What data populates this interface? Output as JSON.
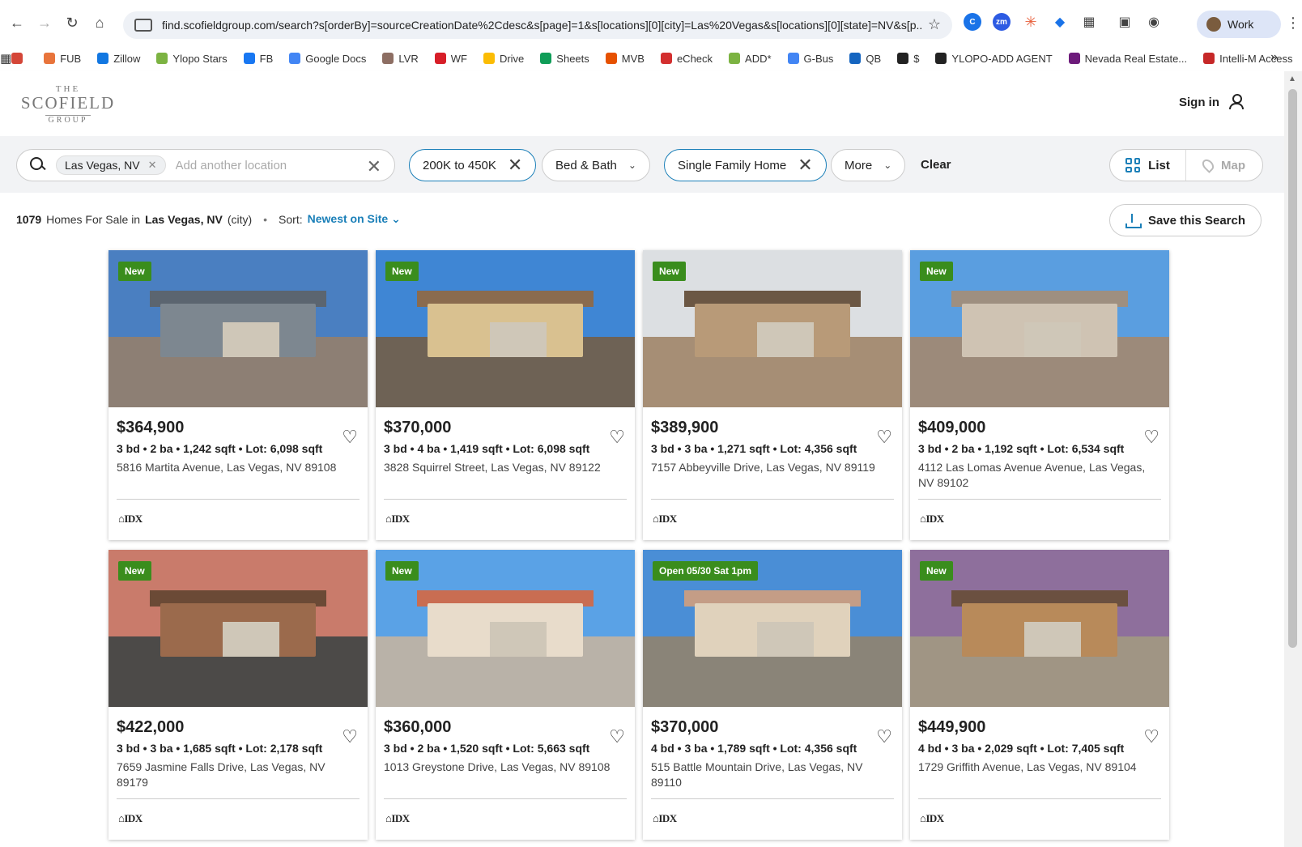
{
  "browser": {
    "url": "find.scofieldgroup.com/search?s[orderBy]=sourceCreationDate%2Cdesc&s[page]=1&s[locations][0][city]=Las%20Vegas&s[locations][0][state]=NV&s[p...",
    "profile_label": "Work",
    "bookmarks": [
      {
        "label": "",
        "icon": "gmail-icon",
        "color": "#d44638"
      },
      {
        "label": "FUB",
        "icon": "fub-icon",
        "color": "#e8743b"
      },
      {
        "label": "Zillow",
        "icon": "zillow-icon",
        "color": "#1277e1"
      },
      {
        "label": "Ylopo Stars",
        "icon": "ylopo-icon",
        "color": "#7cb342"
      },
      {
        "label": "FB",
        "icon": "facebook-icon",
        "color": "#1877f2"
      },
      {
        "label": "Google Docs",
        "icon": "docs-icon",
        "color": "#4285f4"
      },
      {
        "label": "LVR",
        "icon": "lvr-icon",
        "color": "#8d6e63"
      },
      {
        "label": "WF",
        "icon": "wf-icon",
        "color": "#d71e28"
      },
      {
        "label": "Drive",
        "icon": "drive-icon",
        "color": "#fbbc04"
      },
      {
        "label": "Sheets",
        "icon": "sheets-icon",
        "color": "#0f9d58"
      },
      {
        "label": "MVB",
        "icon": "mvb-icon",
        "color": "#e65100"
      },
      {
        "label": "eCheck",
        "icon": "echeck-icon",
        "color": "#d32f2f"
      },
      {
        "label": "ADD*",
        "icon": "add-icon",
        "color": "#7cb342"
      },
      {
        "label": "G-Bus",
        "icon": "google-icon",
        "color": "#4285f4"
      },
      {
        "label": "QB",
        "icon": "qb-icon",
        "color": "#1565c0"
      },
      {
        "label": "$",
        "icon": "amazon-icon",
        "color": "#222222"
      },
      {
        "label": "YLOPO-ADD AGENT",
        "icon": "ylopo-agent-icon",
        "color": "#222222"
      },
      {
        "label": "Nevada Real Estate...",
        "icon": "nevada-icon",
        "color": "#6d1b7b"
      },
      {
        "label": "Intelli-M Access",
        "icon": "intelli-icon",
        "color": "#c62828"
      }
    ]
  },
  "header": {
    "logo": {
      "the": "THE",
      "main": "SCOFIELD",
      "group": "GROUP"
    },
    "signin_label": "Sign in"
  },
  "filters": {
    "location_chip": "Las Vegas, NV",
    "location_placeholder": "Add another location",
    "price_label": "200K to 450K",
    "bed_bath_label": "Bed & Bath",
    "home_type_label": "Single Family Home",
    "more_label": "More",
    "clear_label": "Clear",
    "view_list_label": "List",
    "view_map_label": "Map"
  },
  "results": {
    "count": "1079",
    "text_mid": "Homes For Sale in",
    "location": "Las Vegas, NV",
    "location_suffix": "(city)",
    "sort_label": "Sort:",
    "sort_value": "Newest on Site",
    "save_search_label": "Save this Search"
  },
  "listings": [
    {
      "badge": "New",
      "price": "$364,900",
      "specs": "3 bd • 2 ba • 1,242 sqft • Lot: 6,098 sqft",
      "address": "5816 Martita Avenue, Las Vegas, NV 89108",
      "sky": "#4a7fc1",
      "ground": "#8d7f74",
      "house": "#7d8790",
      "roof": "#5b6570"
    },
    {
      "badge": "New",
      "price": "$370,000",
      "specs": "3 bd • 4 ba • 1,419 sqft • Lot: 6,098 sqft",
      "address": "3828 Squirrel Street, Las Vegas, NV 89122",
      "sky": "#3f86d4",
      "ground": "#6e6255",
      "house": "#d9c190",
      "roof": "#8a6b4e"
    },
    {
      "badge": "New",
      "price": "$389,900",
      "specs": "3 bd • 3 ba • 1,271 sqft • Lot: 4,356 sqft",
      "address": "7157 Abbeyville Drive, Las Vegas, NV 89119",
      "sky": "#dcdfe2",
      "ground": "#a68e75",
      "house": "#b89a78",
      "roof": "#6b5744"
    },
    {
      "badge": "New",
      "price": "$409,000",
      "specs": "3 bd • 2 ba • 1,192 sqft • Lot: 6,534 sqft",
      "address": "4112 Las Lomas Avenue Avenue, Las Vegas, NV 89102",
      "sky": "#5a9ee0",
      "ground": "#9c8a7a",
      "house": "#cfc3b3",
      "roof": "#9e8f80"
    },
    {
      "badge": "New",
      "price": "$422,000",
      "specs": "3 bd • 3 ba • 1,685 sqft • Lot: 2,178 sqft",
      "address": "7659 Jasmine Falls Drive, Las Vegas, NV 89179",
      "sky": "#c97b6b",
      "ground": "#4c4a48",
      "house": "#9b6a4c",
      "roof": "#6b4a36"
    },
    {
      "badge": "New",
      "price": "$360,000",
      "specs": "3 bd • 2 ba • 1,520 sqft • Lot: 5,663 sqft",
      "address": "1013 Greystone Drive, Las Vegas, NV 89108",
      "sky": "#5aa2e6",
      "ground": "#b9b2a8",
      "house": "#e8dccb",
      "roof": "#c96d52"
    },
    {
      "badge": "Open 05/30 Sat 1pm",
      "price": "$370,000",
      "specs": "4 bd • 3 ba • 1,789 sqft • Lot: 4,356 sqft",
      "address": "515 Battle Mountain Drive, Las Vegas, NV 89110",
      "sky": "#4a8ed6",
      "ground": "#8a8478",
      "house": "#e0d2bc",
      "roof": "#c49d86"
    },
    {
      "badge": "New",
      "price": "$449,900",
      "specs": "4 bd • 3 ba • 2,029 sqft • Lot: 7,405 sqft",
      "address": "1729 Griffith Avenue, Las Vegas, NV 89104",
      "sky": "#8e6f9c",
      "ground": "#a09584",
      "house": "#b88a5a",
      "roof": "#6b5040"
    }
  ],
  "idx_label": "IDX"
}
